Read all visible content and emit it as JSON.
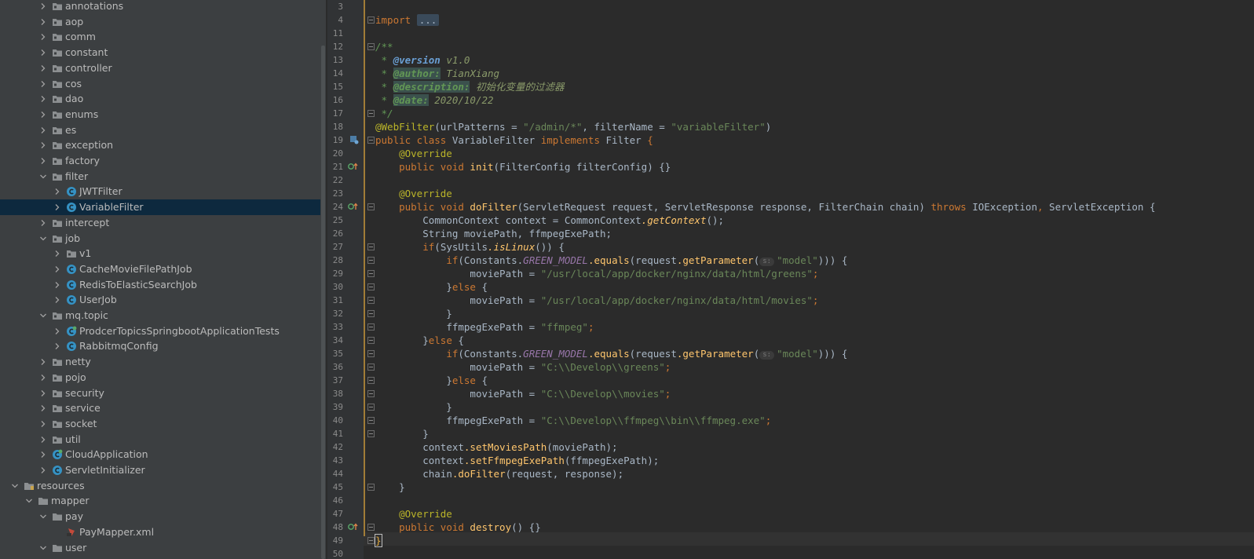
{
  "tree": {
    "items": [
      {
        "label": "annotations",
        "kind": "package",
        "state": "collapsed"
      },
      {
        "label": "aop",
        "kind": "package",
        "state": "collapsed"
      },
      {
        "label": "comm",
        "kind": "package",
        "state": "collapsed"
      },
      {
        "label": "constant",
        "kind": "package",
        "state": "collapsed"
      },
      {
        "label": "controller",
        "kind": "package",
        "state": "collapsed"
      },
      {
        "label": "cos",
        "kind": "package",
        "state": "collapsed"
      },
      {
        "label": "dao",
        "kind": "package",
        "state": "collapsed"
      },
      {
        "label": "enums",
        "kind": "package",
        "state": "collapsed"
      },
      {
        "label": "es",
        "kind": "package",
        "state": "collapsed"
      },
      {
        "label": "exception",
        "kind": "package",
        "state": "collapsed"
      },
      {
        "label": "factory",
        "kind": "package",
        "state": "collapsed"
      },
      {
        "label": "filter",
        "kind": "package",
        "state": "expanded"
      },
      {
        "label": "JWTFilter",
        "kind": "class",
        "state": "collapsed"
      },
      {
        "label": "VariableFilter",
        "kind": "class",
        "state": "collapsed",
        "selected": true
      },
      {
        "label": "intercept",
        "kind": "package",
        "state": "collapsed"
      },
      {
        "label": "job",
        "kind": "package",
        "state": "expanded"
      },
      {
        "label": "v1",
        "kind": "package",
        "state": "collapsed"
      },
      {
        "label": "CacheMovieFilePathJob",
        "kind": "class",
        "state": "collapsed"
      },
      {
        "label": "RedisToElasticSearchJob",
        "kind": "class",
        "state": "collapsed"
      },
      {
        "label": "UserJob",
        "kind": "class",
        "state": "collapsed"
      },
      {
        "label": "mq.topic",
        "kind": "package",
        "state": "expanded"
      },
      {
        "label": "ProdcerTopicsSpringbootApplicationTests",
        "kind": "class-test",
        "state": "collapsed"
      },
      {
        "label": "RabbitmqConfig",
        "kind": "class",
        "state": "collapsed"
      },
      {
        "label": "netty",
        "kind": "package",
        "state": "collapsed"
      },
      {
        "label": "pojo",
        "kind": "package",
        "state": "collapsed"
      },
      {
        "label": "security",
        "kind": "package",
        "state": "collapsed"
      },
      {
        "label": "service",
        "kind": "package",
        "state": "collapsed"
      },
      {
        "label": "socket",
        "kind": "package",
        "state": "collapsed"
      },
      {
        "label": "util",
        "kind": "package",
        "state": "collapsed"
      },
      {
        "label": "CloudApplication",
        "kind": "class-app",
        "state": "collapsed"
      },
      {
        "label": "ServletInitializer",
        "kind": "class",
        "state": "collapsed"
      },
      {
        "label": "resources",
        "kind": "resources",
        "state": "expanded"
      },
      {
        "label": "mapper",
        "kind": "folder",
        "state": "expanded"
      },
      {
        "label": "pay",
        "kind": "folder",
        "state": "expanded"
      },
      {
        "label": "PayMapper.xml",
        "kind": "xml",
        "state": "leaf"
      },
      {
        "label": "user",
        "kind": "folder",
        "state": "expanded"
      }
    ]
  },
  "editor": {
    "line_numbers": [
      "3",
      "4",
      "11",
      "12",
      "13",
      "14",
      "15",
      "16",
      "17",
      "18",
      "19",
      "20",
      "21",
      "22",
      "23",
      "24",
      "25",
      "26",
      "27",
      "28",
      "29",
      "30",
      "31",
      "32",
      "33",
      "34",
      "35",
      "36",
      "37",
      "38",
      "39",
      "40",
      "41",
      "42",
      "43",
      "44",
      "45",
      "46",
      "47",
      "48",
      "49",
      "50"
    ],
    "code": {
      "l4_import": "import",
      "l4_fold": "...",
      "l12": "/**",
      "l13_star": " * ",
      "l13_tag": "@version",
      "l13_val": " v1.0",
      "l14_star": " * ",
      "l14_tag": "@author:",
      "l14_val": " TianXiang",
      "l15_star": " * ",
      "l15_tag": "@description:",
      "l15_val": " 初始化变量的过滤器",
      "l16_star": " * ",
      "l16_tag": "@date:",
      "l16_val": " 2020/10/22",
      "l17": " */",
      "l18_ann": "@WebFilter",
      "l18_a": "(urlPatterns = ",
      "l18_s1": "\"/admin/*\"",
      "l18_b": ", filterName = ",
      "l18_s2": "\"variableFilter\"",
      "l18_c": ")",
      "l19_kw": "public class ",
      "l19_cls": "VariableFilter",
      "l19_kw2": " implements ",
      "l19_iface": "Filter",
      "l19_brace": " {",
      "l20": "    @Override",
      "l21_ind": "    ",
      "l21_kw": "public void ",
      "l21_m": "init",
      "l21_a": "(",
      "l21_t": "FilterConfig",
      "l21_p": " filterConfig",
      "l21_b": ") {}",
      "l23": "    @Override",
      "l24_ind": "    ",
      "l24_kw": "public void ",
      "l24_m": "doFilter",
      "l24_a": "(",
      "l24_t1": "ServletRequest",
      "l24_p1": " request, ",
      "l24_t2": "ServletResponse",
      "l24_p2": " response, ",
      "l24_t3": "FilterChain",
      "l24_p3": " chain) ",
      "l24_kw2": "throws ",
      "l24_e1": "IOException",
      "l24_c": ", ",
      "l24_e2": "ServletException",
      "l24_b": " {",
      "l25_ind": "        ",
      "l25_t": "CommonContext",
      "l25_a": " context = ",
      "l25_t2": "CommonContext",
      "l25_m": ".getContext",
      "l25_b": "();",
      "l26_ind": "        ",
      "l26_t": "String",
      "l26_a": " moviePath, ffmpegExePath;",
      "l27_ind": "        ",
      "l27_kw": "if",
      "l27_a": "(",
      "l27_t": "SysUtils",
      "l27_m": ".isLinux",
      "l27_b": "()) {",
      "l28_ind": "            ",
      "l28_kw": "if",
      "l28_a": "(",
      "l28_t": "Constants",
      "l28_dot": ".",
      "l28_f": "GREEN_MODEL",
      "l28_m": ".equals",
      "l28_b": "(request",
      "l28_m2": ".getParameter",
      "l28_c": "(",
      "l28_hint": "s:",
      "l28_s": "\"model\"",
      "l28_d": "))) {",
      "l29_ind": "                ",
      "l29_a": "moviePath = ",
      "l29_s": "\"/usr/local/app/docker/nginx/data/html/greens\"",
      "l29_b": ";",
      "l30_ind": "            ",
      "l30_a": "}",
      "l30_kw": "else",
      "l30_b": " {",
      "l31_ind": "                ",
      "l31_a": "moviePath = ",
      "l31_s": "\"/usr/local/app/docker/nginx/data/html/movies\"",
      "l31_b": ";",
      "l32": "            }",
      "l33_ind": "            ",
      "l33_a": "ffmpegExePath = ",
      "l33_s": "\"ffmpeg\"",
      "l33_b": ";",
      "l34_ind": "        ",
      "l34_a": "}",
      "l34_kw": "else",
      "l34_b": " {",
      "l35_ind": "            ",
      "l35_kw": "if",
      "l35_a": "(",
      "l35_t": "Constants",
      "l35_dot": ".",
      "l35_f": "GREEN_MODEL",
      "l35_m": ".equals",
      "l35_b": "(request",
      "l35_m2": ".getParameter",
      "l35_c": "(",
      "l35_hint": "s:",
      "l35_s": "\"model\"",
      "l35_d": "))) {",
      "l36_ind": "                ",
      "l36_a": "moviePath = ",
      "l36_s": "\"C:\\\\Develop\\\\greens\"",
      "l36_b": ";",
      "l37_ind": "            ",
      "l37_a": "}",
      "l37_kw": "else",
      "l37_b": " {",
      "l38_ind": "                ",
      "l38_a": "moviePath = ",
      "l38_s": "\"C:\\\\Develop\\\\movies\"",
      "l38_b": ";",
      "l39": "            }",
      "l40_ind": "            ",
      "l40_a": "ffmpegExePath = ",
      "l40_s": "\"C:\\\\Develop\\\\ffmpeg\\\\bin\\\\ffmpeg.exe\"",
      "l40_b": ";",
      "l41": "        }",
      "l42_ind": "        ",
      "l42_a": "context",
      "l42_m": ".setMoviesPath",
      "l42_b": "(moviePath);",
      "l43_ind": "        ",
      "l43_a": "context",
      "l43_m": ".setFfmpegExePath",
      "l43_b": "(ffmpegExePath);",
      "l44_ind": "        ",
      "l44_a": "chain",
      "l44_m": ".doFilter",
      "l44_b": "(request, response);",
      "l45": "    }",
      "l47": "    @Override",
      "l48_ind": "    ",
      "l48_kw": "public void ",
      "l48_m": "destroy",
      "l48_b": "() {}",
      "l49": "}"
    }
  },
  "colors": {
    "tree_bg": "#3c3f41",
    "selection": "#0d293e",
    "editor_bg": "#2b2b2b",
    "gutter_bg": "#313335",
    "class_icon": "#3592c4",
    "folder_icon": "#8c8f91"
  }
}
